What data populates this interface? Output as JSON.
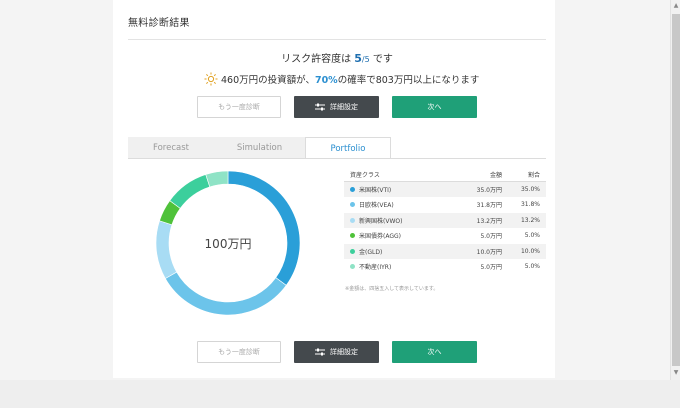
{
  "header": {
    "title": "無料診断結果"
  },
  "risk": {
    "prefix": "リスク許容度は",
    "value": "5",
    "denominator": "/5",
    "suffix": "です"
  },
  "projection": {
    "amount": "460万円の投資額が、",
    "probability": "70%",
    "rest": "の確率で803万円以上になります"
  },
  "buttons_top": {
    "retry": "もう一度診断",
    "settings": "詳細設定",
    "next": "次へ"
  },
  "tabs": [
    {
      "label": "Forecast",
      "active": false
    },
    {
      "label": "Simulation",
      "active": false
    },
    {
      "label": "Portfolio",
      "active": true
    }
  ],
  "chart_data": {
    "type": "pie",
    "center_label": "100万円",
    "values": [
      35.0,
      31.8,
      13.2,
      5.0,
      10.0,
      5.0
    ],
    "categories": [
      "米国株(VTI)",
      "日欧株(VEA)",
      "新興国株(VWO)",
      "米国債券(AGG)",
      "金(GLD)",
      "不動産(IYR)"
    ],
    "colors": [
      "#2a9fd8",
      "#6cc4ea",
      "#a8dcf4",
      "#4fc23a",
      "#3ccf9c",
      "#8fe3c6"
    ]
  },
  "table": {
    "headers": {
      "name": "資産クラス",
      "amount": "金額",
      "ratio": "割合"
    },
    "rows": [
      {
        "name": "米国株(VTI)",
        "amount": "35.0万円",
        "ratio": "35.0%",
        "color": "#2a9fd8"
      },
      {
        "name": "日欧株(VEA)",
        "amount": "31.8万円",
        "ratio": "31.8%",
        "color": "#6cc4ea"
      },
      {
        "name": "新興国株(VWO)",
        "amount": "13.2万円",
        "ratio": "13.2%",
        "color": "#a8dcf4"
      },
      {
        "name": "米国債券(AGG)",
        "amount": "5.0万円",
        "ratio": "5.0%",
        "color": "#4fc23a"
      },
      {
        "name": "金(GLD)",
        "amount": "10.0万円",
        "ratio": "10.0%",
        "color": "#3ccf9c"
      },
      {
        "name": "不動産(IYR)",
        "amount": "5.0万円",
        "ratio": "5.0%",
        "color": "#8fe3c6"
      }
    ],
    "note": "※金額は、四捨五入して表示しています。"
  },
  "buttons_bottom": {
    "retry": "もう一度診断",
    "settings": "詳細設定",
    "next": "次へ"
  },
  "colors": {
    "accent_blue": "#2b8fd0",
    "dark_button": "#44494d",
    "green_button": "#1fa078"
  }
}
